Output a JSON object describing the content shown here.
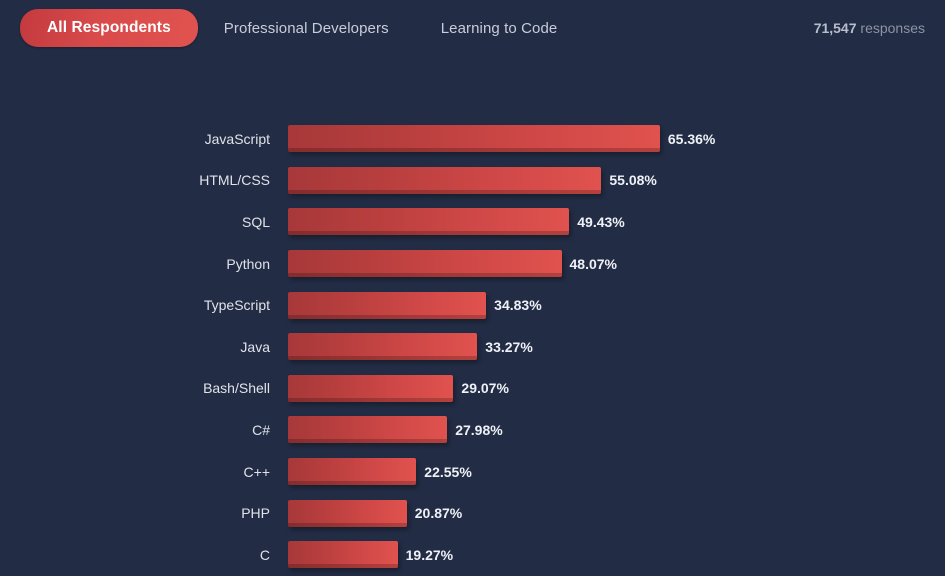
{
  "header": {
    "tabs": [
      {
        "label": "All Respondents",
        "active": true
      },
      {
        "label": "Professional Developers",
        "active": false
      },
      {
        "label": "Learning to Code",
        "active": false
      }
    ],
    "responses": {
      "count": "71,547",
      "word": "responses"
    }
  },
  "colors": {
    "background": "#222c44",
    "bar_start": "#a7383a",
    "bar_end": "#e0524e",
    "accent": "#d94b4b",
    "label_text": "#dfe3ea",
    "value_text": "#eef1f6",
    "tab_text": "#c7cdda"
  },
  "chart_data": {
    "type": "bar",
    "orientation": "horizontal",
    "title": "",
    "xlabel": "",
    "ylabel": "",
    "grid": false,
    "legend": "none",
    "xlim": [
      0,
      65.36
    ],
    "categories": [
      "JavaScript",
      "HTML/CSS",
      "SQL",
      "Python",
      "TypeScript",
      "Java",
      "Bash/Shell",
      "C#",
      "C++",
      "PHP",
      "C"
    ],
    "values": [
      65.36,
      55.08,
      49.43,
      48.07,
      34.83,
      33.27,
      29.07,
      27.98,
      22.55,
      20.87,
      19.27
    ],
    "value_labels": [
      "65.36%",
      "55.08%",
      "49.43%",
      "48.07%",
      "34.83%",
      "33.27%",
      "29.07%",
      "27.98%",
      "22.55%",
      "20.87%",
      "19.27%"
    ],
    "pixels_per_percent": 5.69
  }
}
